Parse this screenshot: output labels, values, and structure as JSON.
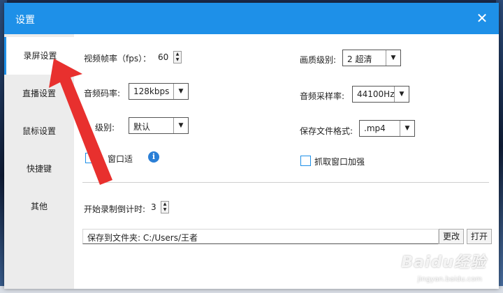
{
  "dialog": {
    "title": "设置",
    "close_glyph": "✕"
  },
  "sidebar": {
    "items": [
      {
        "label": "录屏设置",
        "active": true
      },
      {
        "label": "直播设置",
        "active": false
      },
      {
        "label": "鼠标设置",
        "active": false
      },
      {
        "label": "快捷键",
        "active": false
      },
      {
        "label": "其他",
        "active": false
      }
    ]
  },
  "record": {
    "fps_label": "视频帧率（fps）：",
    "fps_value": "60",
    "quality_label": "画质级别:",
    "quality_value": "2 超清",
    "audio_bitrate_label": "音频码率:",
    "audio_bitrate_value": "128kbps",
    "sample_rate_label": "音频采样率:",
    "sample_rate_value": "44100Hz",
    "level_label": "级别:",
    "level_value": "默认",
    "format_label": "保存文件格式:",
    "format_value": ".mp4",
    "window_fit_label": "窗口适",
    "capture_boost_label": "抓取窗口加强",
    "countdown_label": "开始录制倒计时:",
    "countdown_value": "3",
    "save_path_label": "保存到文件夹:",
    "save_path_value": "C:/Users/王者",
    "change_button": "更改",
    "open_button": "打开"
  },
  "icons": {
    "dropdown_arrow": "▼",
    "spin_up": "▲",
    "spin_down": "▼",
    "info": "i"
  },
  "watermark": {
    "main": "Baidu经验",
    "sub": "jingyan.baidu.com"
  },
  "colors": {
    "titlebar": "#1e90e8",
    "annotation_arrow": "#e8302e"
  }
}
